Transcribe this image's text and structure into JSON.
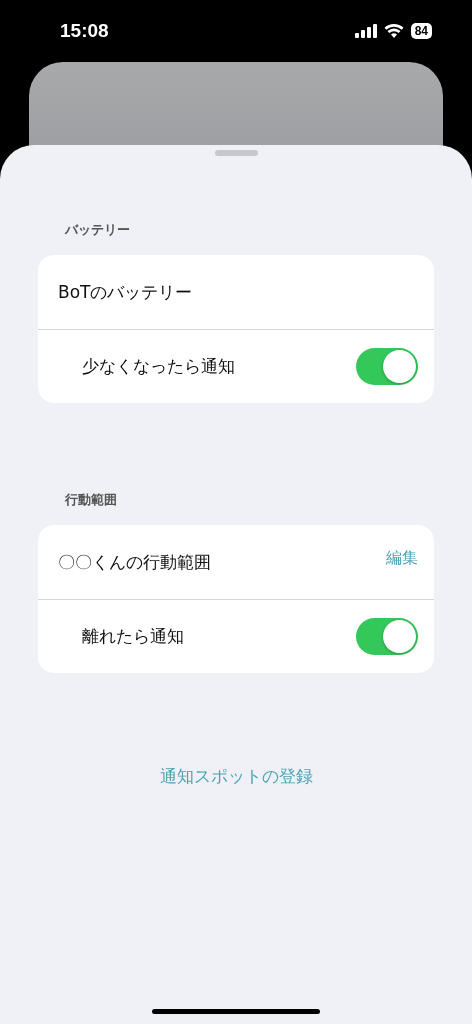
{
  "status_bar": {
    "time": "15:08",
    "battery": "84"
  },
  "sections": [
    {
      "header": "バッテリー",
      "rows": [
        {
          "kind": "title",
          "label": "BoTのバッテリー"
        },
        {
          "kind": "toggle",
          "label": "少なくなったら通知",
          "on": true
        }
      ]
    },
    {
      "header": "行動範囲",
      "rows": [
        {
          "kind": "title",
          "label": "〇〇くんの行動範囲",
          "action": "編集"
        },
        {
          "kind": "toggle",
          "label": "離れたら通知",
          "on": true
        }
      ]
    }
  ],
  "link": "通知スポットの登録"
}
